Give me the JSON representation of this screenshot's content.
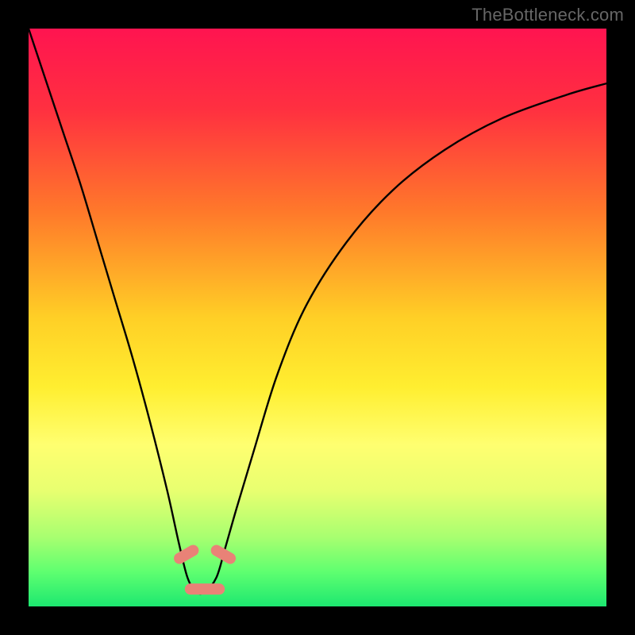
{
  "watermark": "TheBottleneck.com",
  "chart_data": {
    "type": "line",
    "title": "",
    "xlabel": "",
    "ylabel": "",
    "xlim": [
      0,
      100
    ],
    "ylim": [
      0,
      100
    ],
    "background_gradient_stops": [
      {
        "pct": 0,
        "color": "#ff1450"
      },
      {
        "pct": 14,
        "color": "#ff3040"
      },
      {
        "pct": 32,
        "color": "#ff7a2a"
      },
      {
        "pct": 50,
        "color": "#ffcf26"
      },
      {
        "pct": 62,
        "color": "#ffee30"
      },
      {
        "pct": 72,
        "color": "#ffff70"
      },
      {
        "pct": 80,
        "color": "#e8ff70"
      },
      {
        "pct": 88,
        "color": "#a8ff70"
      },
      {
        "pct": 94,
        "color": "#5fff70"
      },
      {
        "pct": 100,
        "color": "#1de870"
      }
    ],
    "series": [
      {
        "name": "bottleneck-curve",
        "stroke": "#000000",
        "x": [
          0,
          3,
          6,
          9,
          12,
          15,
          18,
          21,
          24,
          26,
          27.5,
          29,
          30.5,
          32.5,
          34,
          36,
          39,
          43,
          48,
          55,
          63,
          72,
          82,
          93,
          100
        ],
        "y": [
          100,
          91,
          82,
          73,
          63,
          53,
          43,
          32,
          20,
          11,
          5,
          2.5,
          2.5,
          5,
          10,
          17,
          27,
          40,
          52,
          63,
          72,
          79,
          84.5,
          88.5,
          90.5
        ]
      }
    ],
    "markers": [
      {
        "name": "marker-left",
        "x": 27.3,
        "y": 9.0,
        "color": "#e98277"
      },
      {
        "name": "marker-right",
        "x": 33.7,
        "y": 9.0,
        "color": "#e98277"
      },
      {
        "name": "flat-segment",
        "x0": 28.0,
        "x1": 33.0,
        "y": 3.0,
        "color": "#e98277"
      }
    ]
  }
}
